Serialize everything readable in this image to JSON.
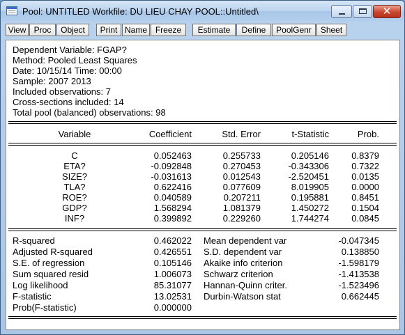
{
  "window": {
    "title": "Pool: UNTITLED   Workfile: DU LIEU CHAY POOL::Untitled\\",
    "close_glyph": "✕"
  },
  "toolbar": [
    "View",
    "Proc",
    "Object",
    "Print",
    "Name",
    "Freeze",
    "Estimate",
    "Define",
    "PoolGenr",
    "Sheet"
  ],
  "header": {
    "dependent": "Dependent Variable: FGAP?",
    "method": "Method: Pooled Least Squares",
    "date": "Date: 10/15/14   Time: 00:00",
    "sample": "Sample: 2007 2013",
    "included": "Included observations: 7",
    "cross": "Cross-sections included: 14",
    "total": "Total pool (balanced) observations: 98"
  },
  "coef_table": {
    "columns": [
      "Variable",
      "Coefficient",
      "Std. Error",
      "t-Statistic",
      "Prob."
    ],
    "rows": [
      [
        "C",
        "0.052463",
        "0.255733",
        "0.205146",
        "0.8379"
      ],
      [
        "ETA?",
        "-0.092848",
        "0.270453",
        "-0.343306",
        "0.7322"
      ],
      [
        "SIZE?",
        "-0.031613",
        "0.012543",
        "-2.520451",
        "0.0135"
      ],
      [
        "TLA?",
        "0.622416",
        "0.077609",
        "8.019905",
        "0.0000"
      ],
      [
        "ROE?",
        "0.040589",
        "0.207211",
        "0.195881",
        "0.8451"
      ],
      [
        "GDP?",
        "1.568294",
        "1.081379",
        "1.450272",
        "0.1504"
      ],
      [
        "INF?",
        "0.399892",
        "0.229260",
        "1.744274",
        "0.0845"
      ]
    ]
  },
  "stats": [
    [
      "R-squared",
      "0.462022",
      "Mean dependent var",
      "-0.047345"
    ],
    [
      "Adjusted R-squared",
      "0.426551",
      "S.D. dependent var",
      "0.138850"
    ],
    [
      "S.E. of regression",
      "0.105146",
      "Akaike info criterion",
      "-1.598179"
    ],
    [
      "Sum squared resid",
      "1.006073",
      "Schwarz criterion",
      "-1.413538"
    ],
    [
      "Log likelihood",
      "85.31077",
      "Hannan-Quinn criter.",
      "-1.523496"
    ],
    [
      "F-statistic",
      "13.02531",
      "Durbin-Watson stat",
      "0.662445"
    ],
    [
      "Prob(F-statistic)",
      "0.000000",
      "",
      ""
    ]
  ]
}
